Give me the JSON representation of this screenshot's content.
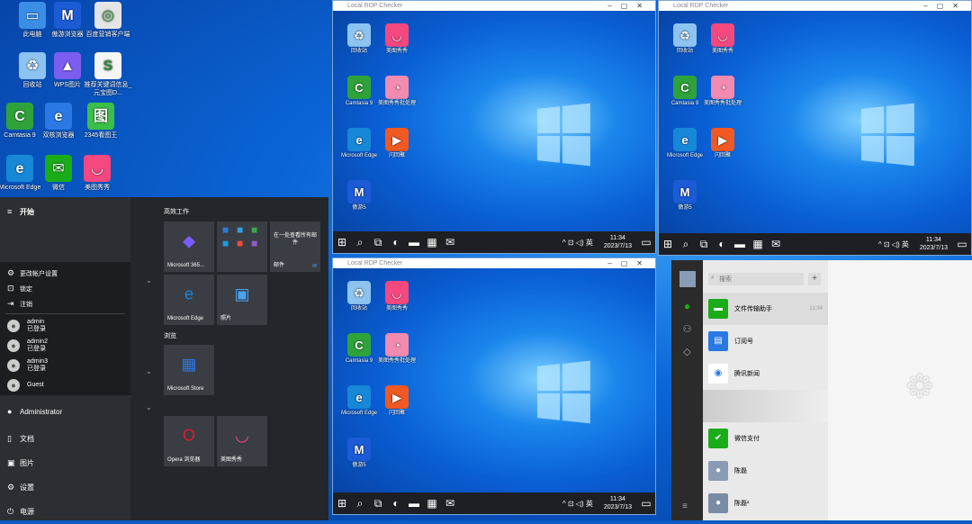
{
  "desktop_icons": [
    {
      "label": "此电脑",
      "icon": "pc-icon",
      "color": "#3a8ee6",
      "glyph": "▭"
    },
    {
      "label": "傲游浏览器",
      "icon": "maxthon-icon",
      "color": "#1c5bd6",
      "glyph": "M"
    },
    {
      "label": "百度营销客户端",
      "icon": "baidu-icon",
      "color": "#e5e5e5",
      "glyph": "◎"
    },
    {
      "label": "回收站",
      "icon": "recycle-bin-icon",
      "color": "#8cc3f0",
      "glyph": "♻"
    },
    {
      "label": "WPS图片",
      "icon": "wps-icon",
      "color": "#7b5df0",
      "glyph": "▲"
    },
    {
      "label": "推荐关键词信息_元宝图D...",
      "icon": "doc-icon",
      "color": "#f5f5f5",
      "glyph": "S"
    },
    {
      "label": "Camtasia 9",
      "icon": "camtasia-icon",
      "color": "#2fa33a",
      "glyph": "C"
    },
    {
      "label": "双核浏览器",
      "icon": "ie-icon",
      "color": "#2a78e4",
      "glyph": "e"
    },
    {
      "label": "2345看图王",
      "icon": "viewer-icon",
      "color": "#3cbf4a",
      "glyph": "图"
    },
    {
      "label": "Microsoft Edge",
      "icon": "edge-icon",
      "color": "#1787d8",
      "glyph": "e"
    },
    {
      "label": "微信",
      "icon": "wechat-icon",
      "color": "#1aad19",
      "glyph": "✉"
    },
    {
      "label": "美图秀秀",
      "icon": "meitu-icon",
      "color": "#f5487f",
      "glyph": "◡"
    }
  ],
  "windows": [
    {
      "title": "Local RDP Checker"
    },
    {
      "title": "Local RDP Checker"
    },
    {
      "title": "Local RDP Checker"
    }
  ],
  "remote_icons": [
    {
      "label": "回收站",
      "color": "#8cc3f0",
      "glyph": "♻",
      "icon": "recycle-bin-icon"
    },
    {
      "label": "美图秀秀",
      "color": "#f5487f",
      "glyph": "◡",
      "icon": "meitu-icon"
    },
    {
      "label": "Camtasia 9",
      "color": "#2fa33a",
      "glyph": "C",
      "icon": "camtasia-icon"
    },
    {
      "label": "美图秀秀批处理",
      "color": "#f38ab0",
      "glyph": "◔",
      "icon": "meitu-batch-icon"
    },
    {
      "label": "Microsoft Edge",
      "color": "#1787d8",
      "glyph": "e",
      "icon": "edge-icon"
    },
    {
      "label": "闪回聚",
      "color": "#f05a22",
      "glyph": "▶",
      "icon": "flash-icon"
    },
    {
      "label": "傲游5",
      "color": "#1c5bd6",
      "glyph": "M",
      "icon": "maxthon-icon"
    }
  ],
  "clock": {
    "time": "11:34",
    "date": "2023/7/13",
    "ime": "英"
  },
  "start_menu": {
    "title": "开始",
    "account_items": [
      "更改帐户设置",
      "锁定",
      "注销"
    ],
    "users": [
      {
        "name": "admin",
        "status": "已登录"
      },
      {
        "name": "admin2",
        "status": "已登录"
      },
      {
        "name": "admin3",
        "status": "已登录"
      },
      {
        "name": "Guest",
        "status": ""
      }
    ],
    "current_user": "Administrator",
    "nav": [
      "文档",
      "图片",
      "设置",
      "电源"
    ],
    "groups": [
      "高效工作",
      "浏览"
    ],
    "tiles": [
      {
        "label": "Microsoft 365...",
        "glyph": "◆",
        "color": "#7a5cff"
      },
      {
        "label": "Microsoft Edge",
        "glyph": "e",
        "color": "#1787d8"
      },
      {
        "label": "照片",
        "glyph": "▣",
        "color": "#4aa3f0"
      },
      {
        "label": "Microsoft Store",
        "glyph": "▦",
        "color": "#2a78e4"
      },
      {
        "label": "Opera 浏览器",
        "glyph": "O",
        "color": "#e5192d"
      },
      {
        "label": "美图秀秀",
        "glyph": "◡",
        "color": "#f5487f"
      }
    ],
    "mail_tile": {
      "text": "在一处查看所有邮件",
      "label": "邮件"
    }
  },
  "wechat": {
    "search_placeholder": "搜索",
    "add": "+",
    "chats": [
      {
        "name": "文件传输助手",
        "time": "11:34",
        "color": "#1aad19"
      },
      {
        "name": "订阅号",
        "time": "",
        "color": "#2a78e4"
      },
      {
        "name": "腾讯新闻",
        "time": "",
        "color": "#ffffff"
      },
      {
        "name": "微信支付",
        "time": "",
        "color": "#1aad19"
      },
      {
        "name": "陈磊",
        "time": "",
        "color": "#8a9bb5"
      },
      {
        "name": "陈磊²",
        "time": "",
        "color": "#7a8ba5"
      }
    ]
  }
}
